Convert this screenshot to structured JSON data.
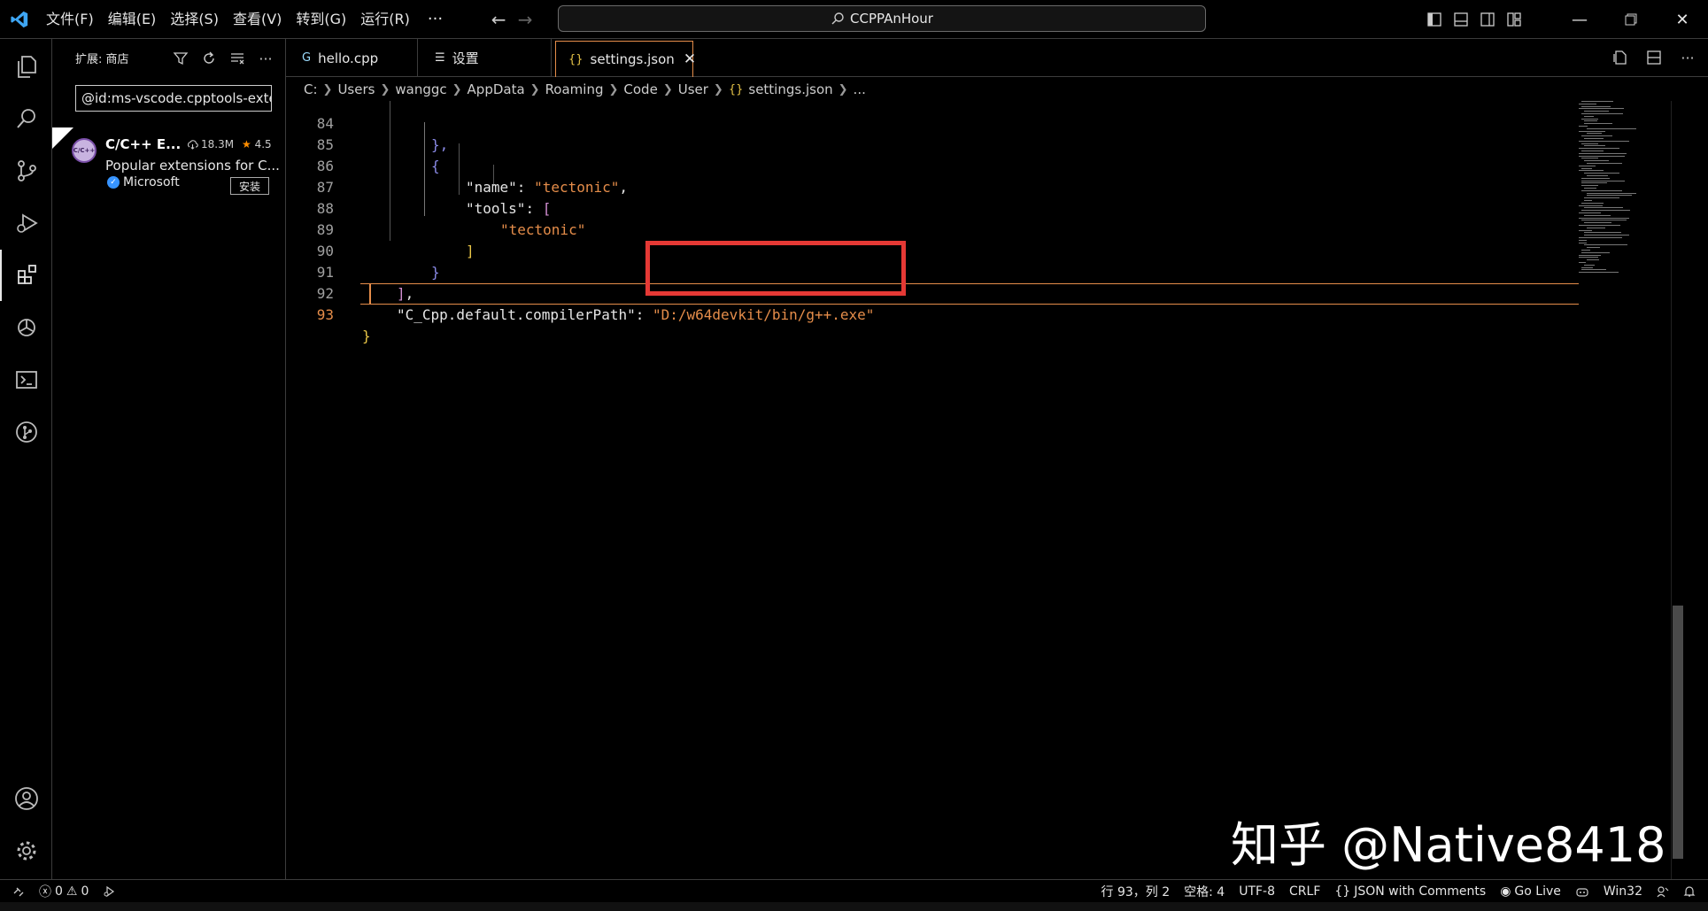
{
  "titlebar": {
    "menus": [
      "文件(F)",
      "编辑(E)",
      "选择(S)",
      "查看(V)",
      "转到(G)",
      "运行(R)"
    ],
    "more": "···",
    "search_text": "CCPPAnHour"
  },
  "sidebar": {
    "title": "扩展: 商店",
    "search_value": "@id:ms-vscode.cpptools-exte",
    "extension": {
      "name": "C/C++ E...",
      "downloads": "18.3M",
      "rating": "4.5",
      "description": "Popular extensions for C...",
      "publisher": "Microsoft",
      "install_label": "安装",
      "logo_text": "C/C++"
    }
  },
  "tabs": [
    {
      "label": "hello.cpp",
      "icon": "c-plus-plus-file-icon",
      "icon_glyph": "G"
    },
    {
      "label": "设置",
      "icon": "settings-list-icon",
      "icon_glyph": "☰"
    },
    {
      "label": "settings.json",
      "icon": "json-braces-icon",
      "icon_glyph": "{}",
      "active": true
    }
  ],
  "breadcrumb": [
    "C:",
    "Users",
    "wanggc",
    "AppData",
    "Roaming",
    "Code",
    "User",
    "settings.json",
    "..."
  ],
  "breadcrumb_json_icon": "{}",
  "editor": {
    "line_numbers": [
      "84",
      "85",
      "86",
      "87",
      "88",
      "89",
      "90",
      "91",
      "92",
      "93"
    ],
    "line84": "},",
    "line85": "{",
    "line86_key": "\"name\"",
    "line86_val": "\"tectonic\"",
    "line87_key": "\"tools\"",
    "line87_br": "[",
    "line88_val": "\"tectonic\"",
    "line89": "]",
    "line90": "}",
    "line91_br": "]",
    "line92_key": "\"C_Cpp.default.compilerPath\"",
    "line92_val": "\"D:/w64devkit/bin/g++.exe\"",
    "line93": "}"
  },
  "status": {
    "errors": "0",
    "warnings": "0",
    "position": "行 93，列 2",
    "spaces": "空格: 4",
    "encoding": "UTF-8",
    "eol": "CRLF",
    "language": "JSON with Comments",
    "golive": "Go Live",
    "platform": "Win32"
  },
  "watermark": "知乎 @Native8418",
  "colors": {
    "accent": "#e58d4a",
    "highlight_box": "#e53935",
    "string": "#e58d4a"
  }
}
